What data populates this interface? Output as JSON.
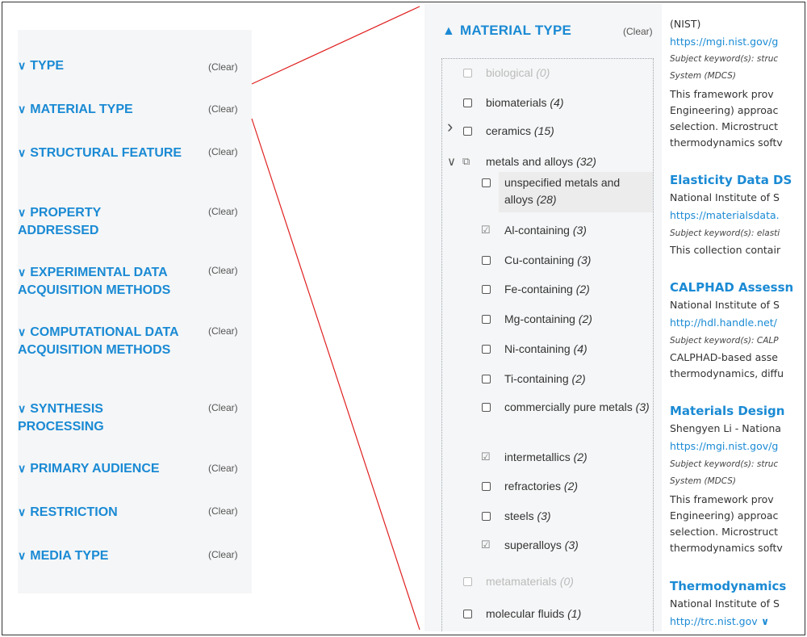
{
  "left_panel": {
    "clear_label": "(Clear)",
    "facets": [
      {
        "label": "TYPE"
      },
      {
        "label": "MATERIAL TYPE"
      },
      {
        "label": "STRUCTURAL FEATURE"
      },
      {
        "label": "PROPERTY ADDRESSED"
      },
      {
        "label": "EXPERIMENTAL DATA ACQUISITION METHODS"
      },
      {
        "label": "COMPUTATIONAL DATA ACQUISITION METHODS"
      },
      {
        "label": "SYNTHESIS PROCESSING"
      },
      {
        "label": "PRIMARY AUDIENCE"
      },
      {
        "label": "RESTRICTION"
      },
      {
        "label": "MEDIA TYPE"
      }
    ]
  },
  "material_panel": {
    "header": "MATERIAL TYPE",
    "clear_label": "(Clear)",
    "items": [
      {
        "label": "biological",
        "count": "(0)",
        "state": "disabled"
      },
      {
        "label": "biomaterials",
        "count": "(4)",
        "state": "unchecked"
      },
      {
        "label": "ceramics",
        "count": "(15)",
        "state": "unchecked",
        "expandable": "collapsed"
      },
      {
        "label": "metals and alloys",
        "count": "(32)",
        "state": "partial",
        "expandable": "expanded"
      },
      {
        "label": "unspecified metals and alloys",
        "count": "(28)",
        "state": "unchecked",
        "level": 2
      },
      {
        "label": "Al-containing",
        "count": "(3)",
        "state": "checked",
        "level": 2
      },
      {
        "label": "Cu-containing",
        "count": "(3)",
        "state": "unchecked",
        "level": 2
      },
      {
        "label": "Fe-containing",
        "count": "(2)",
        "state": "unchecked",
        "level": 2
      },
      {
        "label": "Mg-containing",
        "count": "(2)",
        "state": "unchecked",
        "level": 2
      },
      {
        "label": "Ni-containing",
        "count": "(4)",
        "state": "unchecked",
        "level": 2
      },
      {
        "label": "Ti-containing",
        "count": "(2)",
        "state": "unchecked",
        "level": 2
      },
      {
        "label": "commercially pure metals",
        "count": "(3)",
        "state": "unchecked",
        "level": 2
      },
      {
        "label": "intermetallics",
        "count": "(2)",
        "state": "checked",
        "level": 2
      },
      {
        "label": "refractories",
        "count": "(2)",
        "state": "unchecked",
        "level": 2
      },
      {
        "label": "steels",
        "count": "(3)",
        "state": "unchecked",
        "level": 2
      },
      {
        "label": "superalloys",
        "count": "(3)",
        "state": "checked",
        "level": 2
      },
      {
        "label": "metamaterials",
        "count": "(0)",
        "state": "disabled"
      },
      {
        "label": "molecular fluids",
        "count": "(1)",
        "state": "unchecked"
      }
    ]
  },
  "results": {
    "lines": [
      {
        "text": "(NIST)",
        "kind": "text"
      },
      {
        "text": "https://mgi.nist.gov/g",
        "kind": "link"
      },
      {
        "text": "Subject keyword(s): struc",
        "kind": "kw"
      },
      {
        "text": "System (MDCS)",
        "kind": "kw"
      },
      {
        "text": "This framework prov",
        "kind": "text"
      },
      {
        "text": "Engineering) approac",
        "kind": "text"
      },
      {
        "text": "selection. Microstruct",
        "kind": "text"
      },
      {
        "text": "thermodynamics softv",
        "kind": "text"
      },
      {
        "text": "Elasticity Data DS",
        "kind": "title"
      },
      {
        "text": "National Institute of S",
        "kind": "text"
      },
      {
        "text": "https://materialsdata.",
        "kind": "link"
      },
      {
        "text": "Subject keyword(s): elasti",
        "kind": "kw"
      },
      {
        "text": "This collection contair",
        "kind": "text"
      },
      {
        "text": "CALPHAD Assessn",
        "kind": "title"
      },
      {
        "text": "National Institute of S",
        "kind": "text"
      },
      {
        "text": "http://hdl.handle.net/",
        "kind": "link"
      },
      {
        "text": "Subject keyword(s): CALP",
        "kind": "kw"
      },
      {
        "text": "CALPHAD-based asse",
        "kind": "text"
      },
      {
        "text": "thermodynamics, diffu",
        "kind": "text"
      },
      {
        "text": "Materials Design ",
        "kind": "title"
      },
      {
        "text": "Shengyen Li - Nationa",
        "kind": "text"
      },
      {
        "text": "https://mgi.nist.gov/g",
        "kind": "link"
      },
      {
        "text": "Subject keyword(s): struc",
        "kind": "kw"
      },
      {
        "text": "System (MDCS)",
        "kind": "kw"
      },
      {
        "text": "This framework prov",
        "kind": "text"
      },
      {
        "text": "Engineering) approac",
        "kind": "text"
      },
      {
        "text": "selection. Microstruct",
        "kind": "text"
      },
      {
        "text": "thermodynamics softv",
        "kind": "text"
      },
      {
        "text": "Thermodynamics",
        "kind": "title"
      },
      {
        "text": "National Institute of S",
        "kind": "text"
      },
      {
        "text": "http://trc.nist.gov",
        "kind": "link",
        "chevron": true
      }
    ]
  },
  "colors": {
    "accent": "#1a8ad4",
    "connector": "#e02020",
    "panel_bg": "#f5f6f7"
  }
}
